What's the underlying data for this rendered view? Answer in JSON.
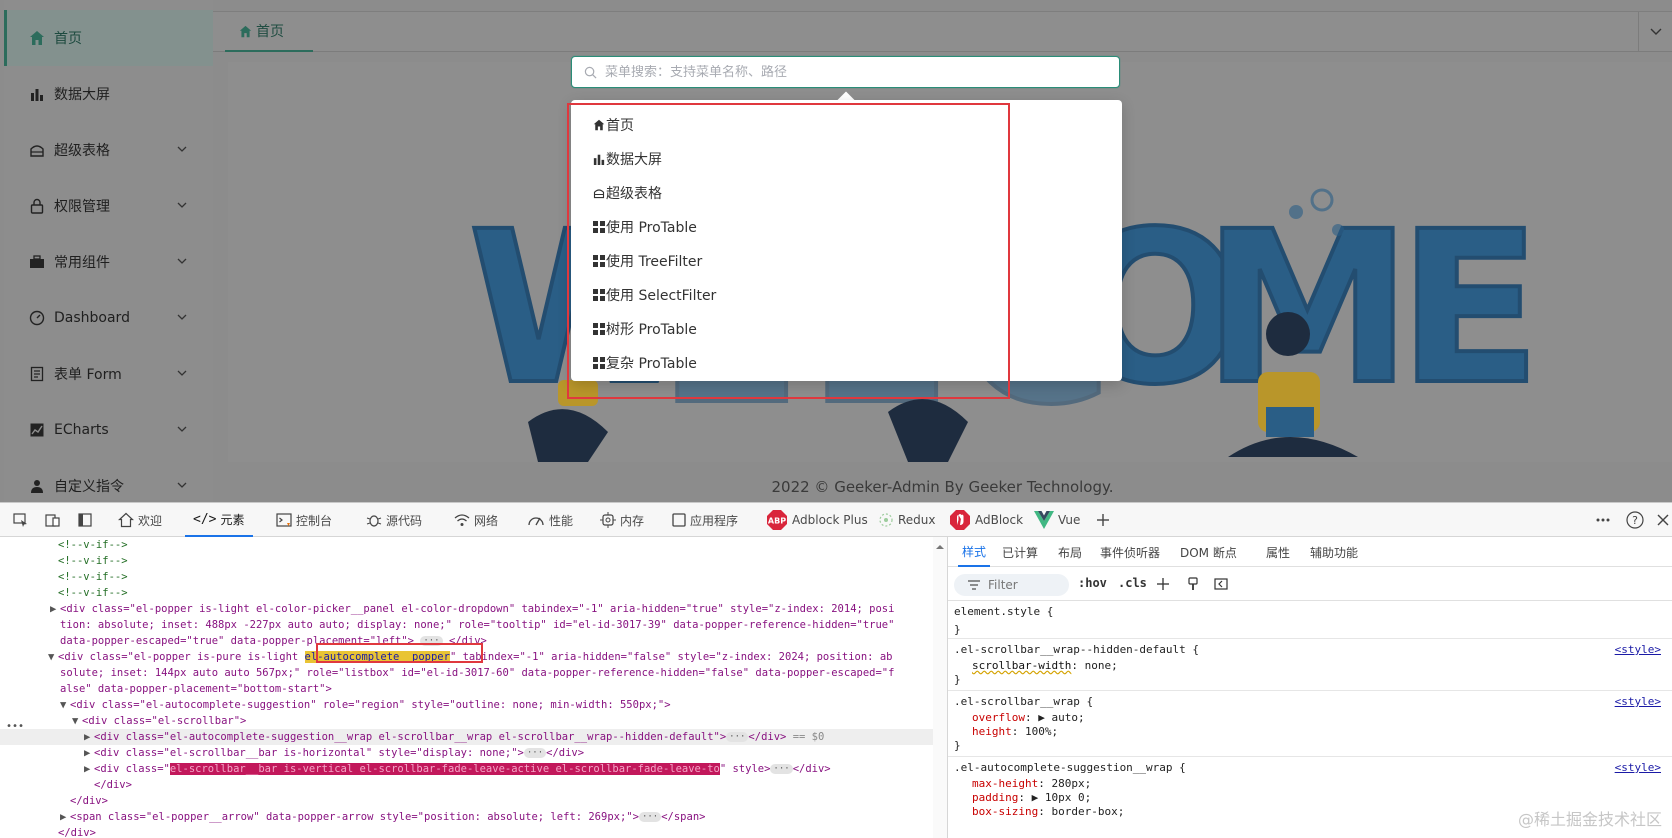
{
  "sidebar": {
    "items": [
      {
        "label": "首页",
        "icon": "home-icon",
        "active": true,
        "has_children": false
      },
      {
        "label": "数据大屏",
        "icon": "bar-chart-icon",
        "active": false,
        "has_children": false
      },
      {
        "label": "超级表格",
        "icon": "table-icon",
        "active": false,
        "has_children": true
      },
      {
        "label": "权限管理",
        "icon": "lock-icon",
        "active": false,
        "has_children": true
      },
      {
        "label": "常用组件",
        "icon": "briefcase-icon",
        "active": false,
        "has_children": true
      },
      {
        "label": "Dashboard",
        "icon": "dashboard-icon",
        "active": false,
        "has_children": true
      },
      {
        "label": "表单 Form",
        "icon": "form-icon",
        "active": false,
        "has_children": true
      },
      {
        "label": "ECharts",
        "icon": "line-chart-icon",
        "active": false,
        "has_children": true
      },
      {
        "label": "自定义指令",
        "icon": "user-icon",
        "active": false,
        "has_children": true
      }
    ]
  },
  "tabs": {
    "home_label": "首页"
  },
  "main": {
    "welcome_letters": [
      "W",
      "E",
      "L",
      "C",
      "O",
      "M",
      "E"
    ],
    "footer": "2022 © Geeker-Admin By Geeker Technology."
  },
  "search": {
    "placeholder": "菜单搜索：支持菜单名称、路径",
    "suggestions": [
      {
        "label": "首页",
        "icon": "home-icon"
      },
      {
        "label": "数据大屏",
        "icon": "bar-chart-icon"
      },
      {
        "label": "超级表格",
        "icon": "table-icon"
      },
      {
        "label": "使用 ProTable",
        "icon": "grid-icon"
      },
      {
        "label": "使用 TreeFilter",
        "icon": "grid-icon"
      },
      {
        "label": "使用 SelectFilter",
        "icon": "grid-icon"
      },
      {
        "label": "树形 ProTable",
        "icon": "grid-icon"
      },
      {
        "label": "复杂 ProTable",
        "icon": "grid-icon"
      }
    ]
  },
  "devtools": {
    "tabs": [
      {
        "label": "欢迎",
        "icon": "home-icon"
      },
      {
        "label": "元素",
        "icon": "code-icon",
        "active": true
      },
      {
        "label": "控制台",
        "icon": "console-icon"
      },
      {
        "label": "源代码",
        "icon": "bug-icon"
      },
      {
        "label": "网络",
        "icon": "wifi-icon"
      },
      {
        "label": "性能",
        "icon": "performance-icon"
      },
      {
        "label": "内存",
        "icon": "chip-icon"
      },
      {
        "label": "应用程序",
        "icon": "app-icon"
      },
      {
        "label": "Adblock Plus",
        "icon": "abp-icon"
      },
      {
        "label": "Redux",
        "icon": "redux-icon"
      },
      {
        "label": "AdBlock",
        "icon": "adblock-icon"
      },
      {
        "label": "Vue",
        "icon": "vue-icon"
      }
    ],
    "dom": {
      "comments": [
        "<!--v-if-->",
        "<!--v-if-->",
        "<!--v-if-->",
        "<!--v-if-->"
      ],
      "line_color_picker_1": "<div class=\"el-popper is-light el-color-picker__panel el-color-dropdown\" tabindex=\"-1\" aria-hidden=\"true\" style=\"z-index: 2014; posi",
      "line_color_picker_2": "tion: absolute; inset: 488px -227px auto auto; display: none;\" role=\"tooltip\" id=\"el-id-3017-39\" data-popper-reference-hidden=\"true\"",
      "line_color_picker_3a": "data-popper-escaped=\"true\" data-popper-placement=\"left\">",
      "line_color_picker_3b": "</div>",
      "line_popper_1a": "<div class=\"el-popper is-pure is-light ",
      "line_popper_1mark": "el-autocomplete__popper",
      "line_popper_1b": "\" tabindex=\"-1\" aria-hidden=\"false\" style=\"z-index: 2024; position: ab",
      "line_popper_2": "solute; inset: 144px auto auto 567px;\" role=\"listbox\" id=\"el-id-3017-60\" data-popper-reference-hidden=\"false\" data-popper-escaped=\"f",
      "line_popper_3": "alse\" data-popper-placement=\"bottom-start\">",
      "line_suggestion": "<div class=\"el-autocomplete-suggestion\" role=\"region\" style=\"outline: none; min-width: 550px;\">",
      "line_scrollbar": "<div class=\"el-scrollbar\">",
      "line_wrap_a": "<div class=\"el-autocomplete-suggestion__wrap el-scrollbar__wrap el-scrollbar__wrap--hidden-default\">",
      "line_wrap_b": "</div>",
      "line_wrap_eq": "== $0",
      "line_bar_h_a": "<div class=\"el-scrollbar__bar is-horizontal\" style=\"display: none;\">",
      "line_bar_h_b": "</div>",
      "line_bar_v_a": "<div class=\"",
      "line_bar_v_mark": "el-scrollbar__bar is-vertical el-scrollbar-fade-leave-active el-scrollbar-fade-leave-to",
      "line_bar_v_b": "\" style>",
      "line_bar_v_c": "</div>",
      "line_close_div1": "</div>",
      "line_close_div2": "</div>",
      "line_arrow_a": "<span class=\"el-popper__arrow\" data-popper-arrow style=\"position: absolute; left: 269px;\">",
      "line_arrow_b": "</span>",
      "line_close_div3": "</div>"
    },
    "styles_tabs": [
      "样式",
      "已计算",
      "布局",
      "事件侦听器",
      "DOM 断点",
      "属性",
      "辅助功能"
    ],
    "filter_placeholder": "Filter",
    "hov": ":hov",
    "cls": ".cls",
    "rules": [
      {
        "selector": "element.style {",
        "source": "",
        "decls": [],
        "close": "}"
      },
      {
        "selector": ".el-scrollbar__wrap--hidden-default {",
        "source": "<style>",
        "decls": [
          {
            "prop": "scrollbar-width",
            "value": "none;"
          }
        ],
        "close": "}"
      },
      {
        "selector": ".el-scrollbar__wrap {",
        "source": "<style>",
        "decls": [
          {
            "prop": "overflow",
            "value": "▶ auto;"
          },
          {
            "prop": "height",
            "value": "100%;"
          }
        ],
        "close": "}"
      },
      {
        "selector": ".el-autocomplete-suggestion__wrap {",
        "source": "<style>",
        "decls": [
          {
            "prop": "max-height",
            "value": "280px;"
          },
          {
            "prop": "padding",
            "value": "▶ 10px 0;"
          },
          {
            "prop": "box-sizing",
            "value": "border-box;"
          }
        ],
        "close": ""
      }
    ],
    "watermark": "@稀土掘金技术社区"
  },
  "colors": {
    "accent": "#2c6c5c",
    "highlight_red": "#e0383e",
    "devtools_blue": "#1a73e8"
  }
}
